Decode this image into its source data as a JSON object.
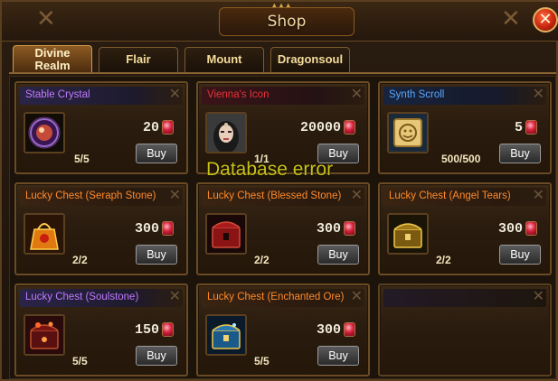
{
  "window": {
    "title": "Shop"
  },
  "tabs": [
    {
      "label_line1": "Divine",
      "label_line2": "Realm",
      "active": true
    },
    {
      "label": "Flair",
      "active": false
    },
    {
      "label": "Mount",
      "active": false
    },
    {
      "label": "Dragonsoul",
      "active": false
    }
  ],
  "items": [
    {
      "name": "Stable Crystal",
      "name_color": "#c07aff",
      "price": "20",
      "stock": "5/5",
      "buy_label": "Buy",
      "icon": "crystal-icon"
    },
    {
      "name": "Vienna's Icon",
      "name_color": "#e8323a",
      "price": "20000",
      "stock": "1/1",
      "buy_label": "Buy",
      "icon": "portrait-icon"
    },
    {
      "name": "Synth Scroll",
      "name_color": "#5aa8ff",
      "price": "5",
      "stock": "500/500",
      "buy_label": "Buy",
      "icon": "scroll-icon"
    },
    {
      "name": "Lucky Chest (Seraph Stone)",
      "name_color": "#ff8a2a",
      "price": "300",
      "stock": "2/2",
      "buy_label": "Buy",
      "icon": "gift-bag-icon"
    },
    {
      "name": "Lucky Chest (Blessed Stone)",
      "name_color": "#ff8a2a",
      "price": "300",
      "stock": "2/2",
      "buy_label": "Buy",
      "icon": "red-chest-icon"
    },
    {
      "name": "Lucky Chest (Angel Tears)",
      "name_color": "#ff8a2a",
      "price": "300",
      "stock": "2/2",
      "buy_label": "Buy",
      "icon": "gold-chest-icon"
    },
    {
      "name": "Lucky Chest (Soulstone)",
      "name_color": "#c07aff",
      "price": "150",
      "stock": "5/5",
      "buy_label": "Buy",
      "icon": "soul-chest-icon"
    },
    {
      "name": "Lucky Chest (Enchanted Ore)",
      "name_color": "#ff8a2a",
      "price": "300",
      "stock": "5/5",
      "buy_label": "Buy",
      "icon": "ore-chest-icon"
    }
  ],
  "overlay": {
    "error_text": "Database error"
  },
  "currency_icon": "ruby-icon"
}
